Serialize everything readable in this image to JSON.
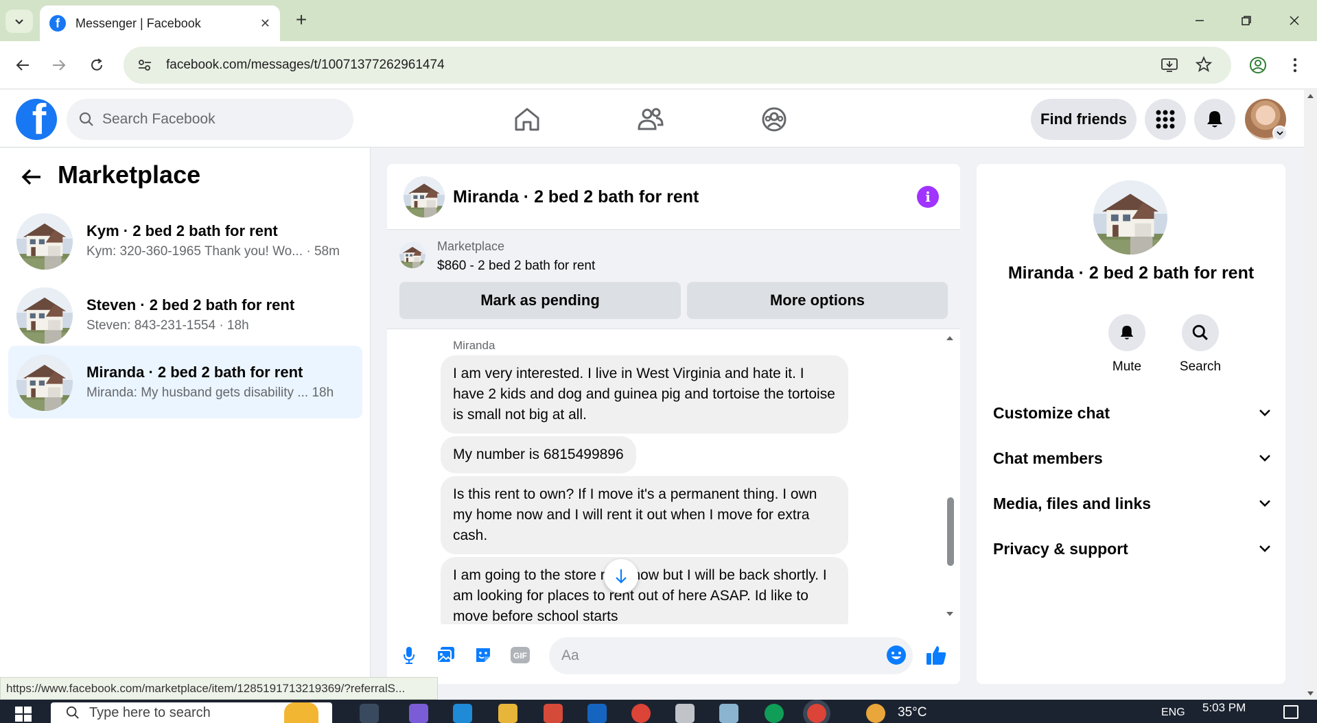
{
  "browser": {
    "tab_title": "Messenger | Facebook",
    "url": "facebook.com/messages/t/10071377262961474",
    "status_url": "https://www.facebook.com/marketplace/item/1285191713219369/?referralS..."
  },
  "facebook": {
    "search_placeholder": "Search Facebook",
    "find_friends_label": "Find friends"
  },
  "left_panel": {
    "title": "Marketplace",
    "conversations": [
      {
        "name": "Kym · 2 bed 2 bath for rent",
        "snippet": "Kym: 320-360-1965 Thank you! Wo...",
        "time": "· 58m",
        "active": false
      },
      {
        "name": "Steven · 2 bed 2 bath for rent",
        "snippet": "Steven: 843-231-1554",
        "time": "· 18h",
        "active": false
      },
      {
        "name": "Miranda · 2 bed 2 bath for rent",
        "snippet": "Miranda: My husband gets disability ...",
        "time": "18h",
        "active": true
      }
    ]
  },
  "chat": {
    "title": "Miranda · 2 bed 2 bath for rent",
    "listing_source": "Marketplace",
    "listing_price": "$860 - 2 bed 2 bath for rent",
    "mark_pending_label": "Mark as pending",
    "more_options_label": "More options",
    "sender_name": "Miranda",
    "messages": [
      "I am very interested. I live in West Virginia and hate it. I have 2 kids and dog and guinea pig and tortoise the tortoise is small not big at all.",
      "My number is 6815499896",
      "Is this rent to own? If I move it's a permanent thing. I own my home now and I will rent it out when I move for extra cash.",
      "I am going to the store right now but I will be back shortly. I am looking for places to rent out of here ASAP. Id like to move before school starts"
    ],
    "composer_placeholder": "Aa"
  },
  "right_panel": {
    "title": "Miranda · 2 bed 2 bath for rent",
    "mute_label": "Mute",
    "search_label": "Search",
    "sections": [
      "Customize chat",
      "Chat members",
      "Media, files and links",
      "Privacy & support"
    ]
  },
  "taskbar": {
    "search_placeholder": "Type here to search",
    "temperature": "35°C",
    "language": "ENG",
    "time": "5:03 PM"
  },
  "colors": {
    "facebook_blue": "#1877f2",
    "messenger_purple": "#a033ff",
    "active_conversation_bg": "#ebf5ff"
  }
}
